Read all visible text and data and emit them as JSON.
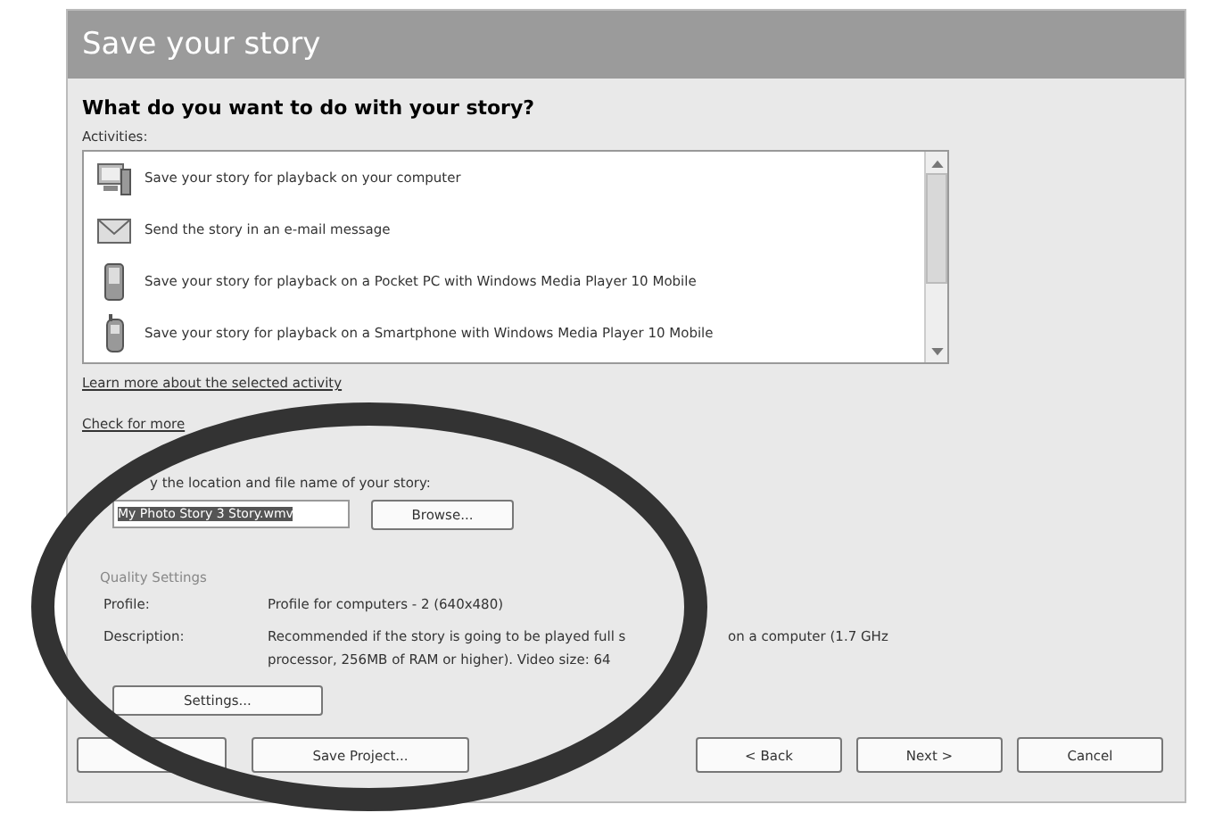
{
  "window": {
    "title": "Save your story"
  },
  "heading": "What do you want to do with your story?",
  "activities": {
    "label": "Activities:",
    "items": [
      {
        "kind": "computer",
        "text": "Save your story for playback on your computer"
      },
      {
        "kind": "mail",
        "text": "Send the story in an e-mail message"
      },
      {
        "kind": "pocketpc",
        "text": "Save your story for playback on a Pocket PC with Windows Media Player 10 Mobile"
      },
      {
        "kind": "phone",
        "text": "Save your story for playback on a Smartphone with Windows Media Player 10 Mobile"
      }
    ]
  },
  "learn_more_link": "Learn more about the selected activity",
  "check_link": "Check for more",
  "file_prompt": "y the location and file name of your story:",
  "file_field": {
    "value": "My Photo Story 3 Story.wmv"
  },
  "browse_button": "Browse...",
  "quality": {
    "label": "Quality Settings",
    "profile_label": "Profile:",
    "profile": "Profile for computers - 2 (640x480)",
    "description_label": "Description:",
    "description": [
      "Recommended if the story is going to be played full s",
      "processor, 256MB of RAM or higher). Video size: 64"
    ],
    "description_tail": "on a computer (1.7 GHz"
  },
  "settings_button": "Settings...",
  "save_project_button": "Save Project...",
  "nav_buttons": [
    "< Back",
    "Next >",
    "Cancel"
  ],
  "annotation": {
    "kind": "ellipse"
  }
}
